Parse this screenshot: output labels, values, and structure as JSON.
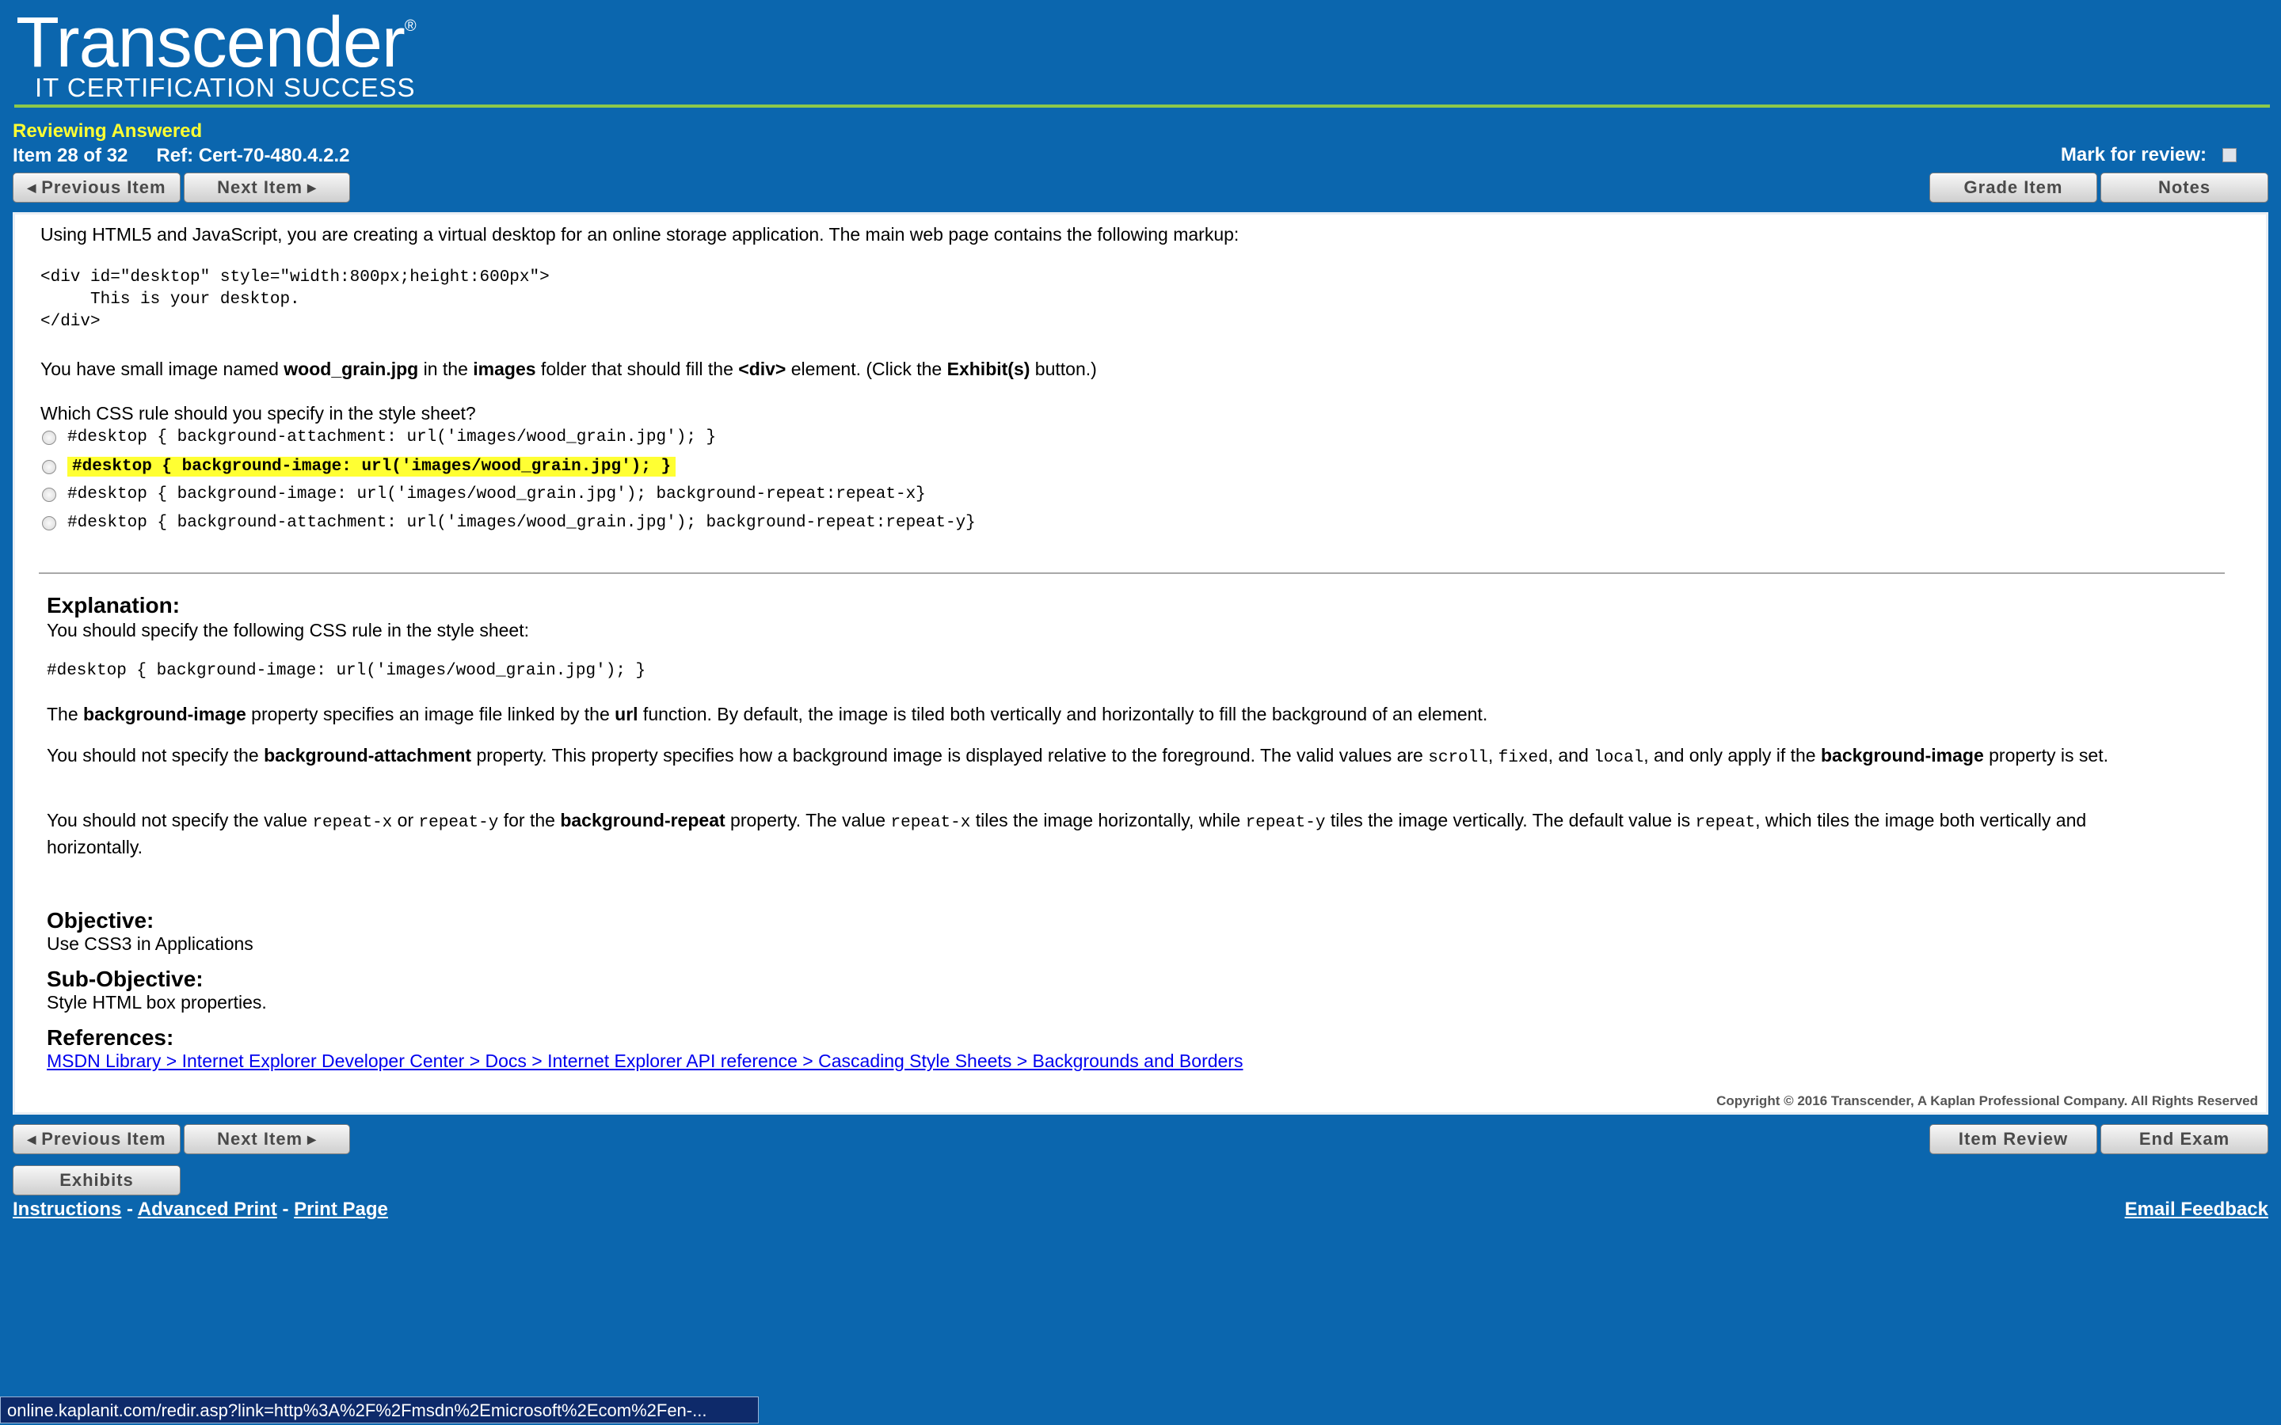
{
  "header": {
    "brand": "Transcender",
    "reg_mark": "®",
    "tagline": "IT CERTIFICATION SUCCESS"
  },
  "status": {
    "mode": "Reviewing Answered",
    "item": "Item 28 of 32",
    "ref": "Ref: Cert-70-480.4.2.2"
  },
  "mark_for_review_label": "Mark for review:",
  "nav": {
    "previous": "Previous Item",
    "next": "Next Item",
    "grade": "Grade Item",
    "notes": "Notes",
    "item_review": "Item Review",
    "end_exam": "End Exam",
    "exhibits": "Exhibits"
  },
  "question": {
    "intro": "Using HTML5 and JavaScript, you are creating a virtual desktop for an online storage application. The main web page contains the following markup:",
    "markup": "<div id=\"desktop\" style=\"width:800px;height:600px\">\n     This is your desktop.\n</div>",
    "line2_a": "You have small image named ",
    "line2_b": "wood_grain.jpg",
    "line2_c": " in the ",
    "line2_d": "images",
    "line2_e": " folder that should fill the ",
    "line2_f": "<div>",
    "line2_g": " element. (Click the ",
    "line2_h": "Exhibit(s)",
    "line2_i": " button.)",
    "prompt": "Which CSS rule should you specify in the style sheet?",
    "options": [
      "#desktop { background-attachment: url('images/wood_grain.jpg'); }",
      "#desktop { background-image: url('images/wood_grain.jpg'); }",
      "#desktop { background-image: url('images/wood_grain.jpg'); background-repeat:repeat-x}",
      "#desktop { background-attachment: url('images/wood_grain.jpg'); background-repeat:repeat-y}"
    ]
  },
  "explanation": {
    "heading": "Explanation:",
    "intro": "You should specify the following CSS rule in the style sheet:",
    "code": "#desktop { background-image: url('images/wood_grain.jpg'); }",
    "p1_a": "The ",
    "p1_b": "background-image",
    "p1_c": " property specifies an image file linked by the ",
    "p1_d": "url",
    "p1_e": " function. By default, the image is tiled both vertically and horizontally to fill the background of an element.",
    "p2_a": "You should not specify the ",
    "p2_b": "background-attachment",
    "p2_c": " property. This property specifies how a background image is displayed relative to the foreground. The valid values are ",
    "p2_d": "scroll",
    "p2_e": ", ",
    "p2_f": "fixed",
    "p2_g": ", and ",
    "p2_h": "local",
    "p2_i": ", and only apply if the ",
    "p2_j": "background-image",
    "p2_k": " property is set.",
    "p3_a": "You should not specify the value ",
    "p3_b": "repeat-x",
    "p3_c": " or ",
    "p3_d": "repeat-y",
    "p3_e": " for the ",
    "p3_f": "background-repeat",
    "p3_g": " property. The value ",
    "p3_h": "repeat-x",
    "p3_i": " tiles the image horizontally, while ",
    "p3_j": "repeat-y",
    "p3_k": " tiles the image vertically. The default value is ",
    "p3_l": "repeat",
    "p3_m": ", which tiles the image both vertically and horizontally."
  },
  "objective": {
    "heading": "Objective:",
    "text": "Use CSS3 in Applications",
    "sub_heading": "Sub-Objective:",
    "sub_text": "Style HTML box properties.",
    "ref_heading": "References:",
    "ref_link": "MSDN Library > Internet Explorer Developer Center > Docs > Internet Explorer API reference > Cascading Style Sheets > Backgrounds and Borders"
  },
  "copyright": "Copyright © 2016 Transcender, A Kaplan Professional Company. All Rights Reserved",
  "footer": {
    "instructions": "Instructions",
    "sep": " - ",
    "advanced_print": "Advanced Print",
    "print_page": "Print Page",
    "email_feedback": "Email Feedback"
  },
  "status_bar_url": "online.kaplanit.com/redir.asp?link=http%3A%2F%2Fmsdn%2Emicrosoft%2Ecom%2Fen-..."
}
